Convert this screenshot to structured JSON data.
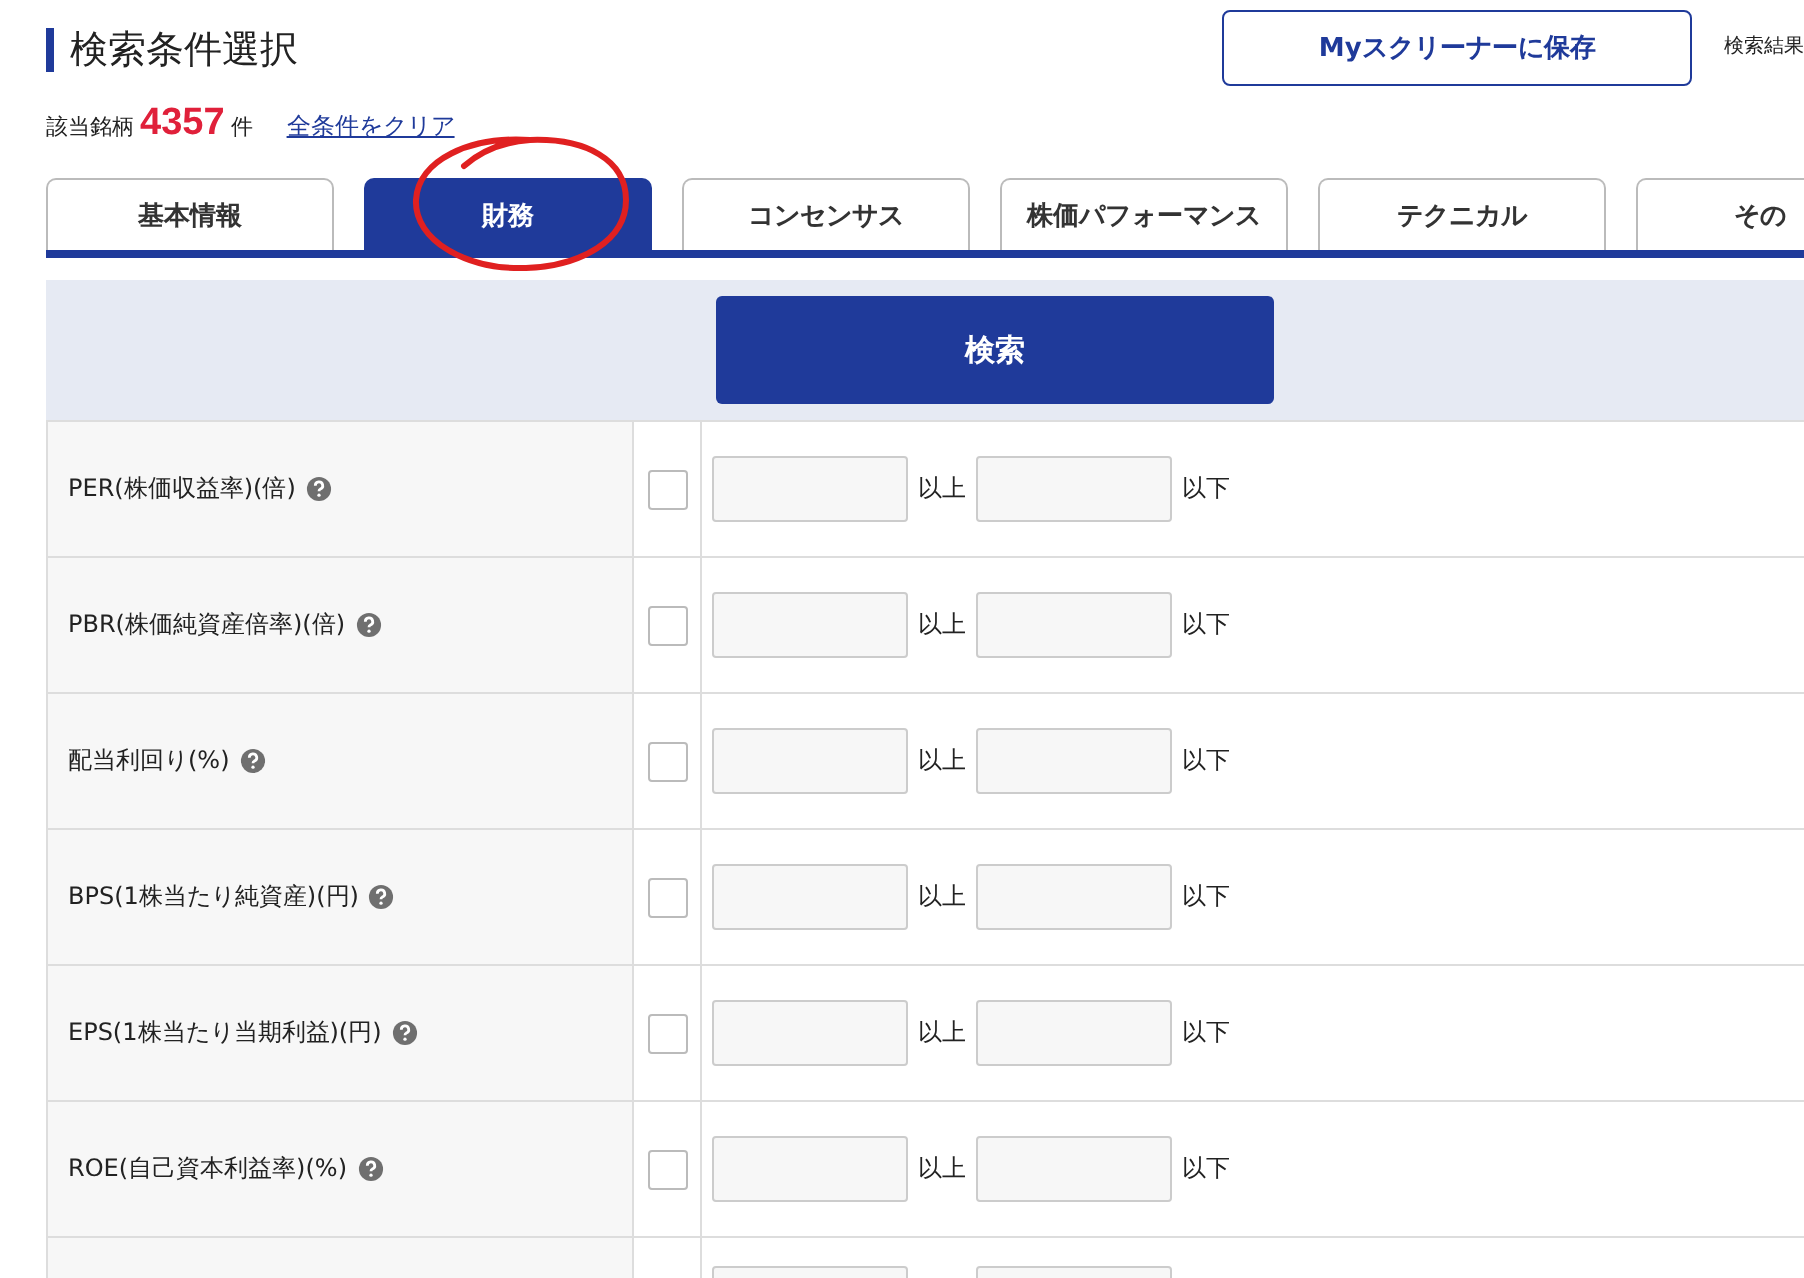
{
  "header": {
    "title": "検索条件選択",
    "save_button": "Myスクリーナーに保存",
    "side_link": "検索結果"
  },
  "count": {
    "label": "該当銘柄",
    "value": "4357",
    "unit": "件",
    "clear_link": "全条件をクリア"
  },
  "tabs": [
    {
      "label": "基本情報",
      "selected": false
    },
    {
      "label": "財務",
      "selected": true
    },
    {
      "label": "コンセンサス",
      "selected": false
    },
    {
      "label": "株価パフォーマンス",
      "selected": false
    },
    {
      "label": "テクニカル",
      "selected": false
    },
    {
      "label": "その",
      "selected": false
    }
  ],
  "annotation": {
    "kind": "circle",
    "color": "#e02020"
  },
  "search_button": "検索",
  "conditions": [
    {
      "label": "PER(株価収益率)(倍)",
      "help": true,
      "checked": false,
      "min_suffix": "以上",
      "max_suffix": "以下"
    },
    {
      "label": "PBR(株価純資産倍率)(倍)",
      "help": true,
      "checked": false,
      "min_suffix": "以上",
      "max_suffix": "以下"
    },
    {
      "label": "配当利回り(%)",
      "help": true,
      "checked": false,
      "min_suffix": "以上",
      "max_suffix": "以下"
    },
    {
      "label": "BPS(1株当たり純資産)(円)",
      "help": true,
      "checked": false,
      "min_suffix": "以上",
      "max_suffix": "以下"
    },
    {
      "label": "EPS(1株当たり当期利益)(円)",
      "help": true,
      "checked": false,
      "min_suffix": "以上",
      "max_suffix": "以下"
    },
    {
      "label": "ROE(自己資本利益率)(%)",
      "help": true,
      "checked": false,
      "min_suffix": "以上",
      "max_suffix": "以下"
    }
  ]
}
